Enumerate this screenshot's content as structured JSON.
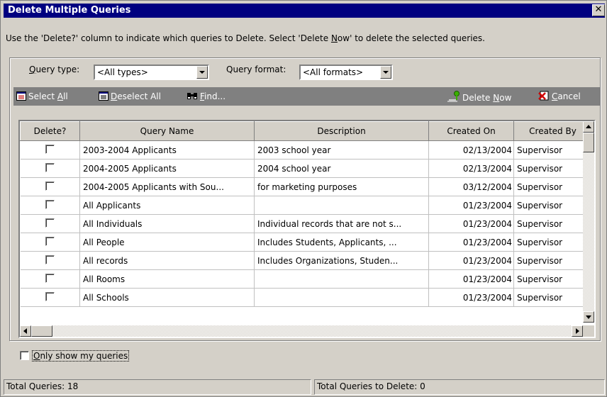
{
  "window": {
    "title": "Delete Multiple Queries",
    "close_glyph": "✕"
  },
  "instructions": {
    "pre": "Use the 'Delete?' column to indicate which queries to Delete.  Select 'Delete ",
    "accel": "N",
    "post": "ow' to delete the selected queries."
  },
  "filters": {
    "query_type_label": "Query type:",
    "query_type_accel": "Q",
    "query_type_value": "<All types>",
    "query_format_label": "Query format:",
    "query_format_value": "<All formats>"
  },
  "toolbar": {
    "select_all_pre": "Select ",
    "select_all_accel": "A",
    "select_all_post": "ll",
    "deselect_all_accel": "D",
    "deselect_all_post": "eselect All",
    "find_accel": "F",
    "find_post": "ind...",
    "delete_now_pre": "Delete ",
    "delete_now_accel": "N",
    "delete_now_post": "ow",
    "cancel_accel": "C",
    "cancel_post": "ancel",
    "colors": {
      "bg": "#808080",
      "text": "#ffffff"
    }
  },
  "grid": {
    "columns": [
      "Delete?",
      "Query Name",
      "Description",
      "Created On",
      "Created By"
    ],
    "rows": [
      {
        "name": "2003-2004 Applicants",
        "description": "2003 school year",
        "created_on": "02/13/2004",
        "created_by": "Supervisor"
      },
      {
        "name": "2004-2005 Applicants",
        "description": "2004 school year",
        "created_on": "02/13/2004",
        "created_by": "Supervisor"
      },
      {
        "name": "2004-2005 Applicants with Sou...",
        "description": "for marketing purposes",
        "created_on": "03/12/2004",
        "created_by": "Supervisor"
      },
      {
        "name": "All Applicants",
        "description": "",
        "created_on": "01/23/2004",
        "created_by": "Supervisor"
      },
      {
        "name": "All Individuals",
        "description": "Individual records that are not s...",
        "created_on": "01/23/2004",
        "created_by": "Supervisor"
      },
      {
        "name": "All People",
        "description": "Includes Students, Applicants, ...",
        "created_on": "01/23/2004",
        "created_by": "Supervisor"
      },
      {
        "name": "All records",
        "description": "Includes Organizations, Studen...",
        "created_on": "01/23/2004",
        "created_by": "Supervisor"
      },
      {
        "name": "All Rooms",
        "description": "",
        "created_on": "01/23/2004",
        "created_by": "Supervisor"
      },
      {
        "name": "All Schools",
        "description": "",
        "created_on": "01/23/2004",
        "created_by": "Supervisor"
      }
    ]
  },
  "only_mine": {
    "accel": "O",
    "post": "nly show my queries"
  },
  "status": {
    "total_queries": "Total Queries: 18",
    "total_to_delete": "Total Queries to Delete: 0"
  }
}
